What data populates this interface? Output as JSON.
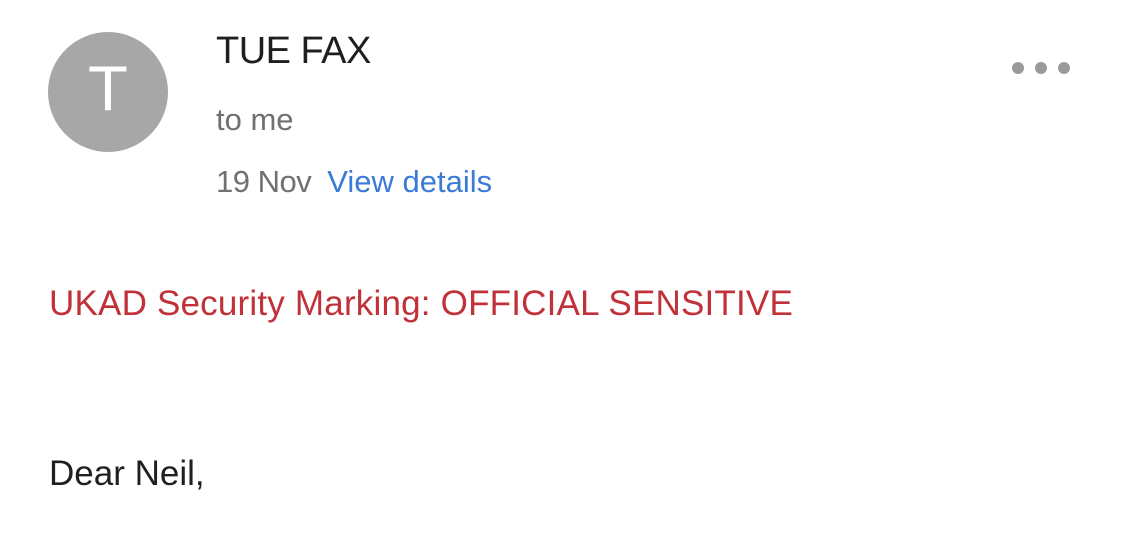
{
  "sender": {
    "avatar_letter": "T",
    "avatar_color": "#a7a7a7",
    "name": "TUE FAX"
  },
  "header": {
    "recipient": "to me",
    "date": "19 Nov",
    "view_details_label": "View details",
    "more_icon": "more-horizontal-icon"
  },
  "body": {
    "security_marking": "UKAD Security Marking: OFFICIAL SENSITIVE",
    "security_marking_color": "#c0313a",
    "greeting": "Dear Neil,"
  },
  "colors": {
    "link": "#3a7bd5",
    "secondary_text": "#707070",
    "primary_text": "#1f1f1f"
  }
}
